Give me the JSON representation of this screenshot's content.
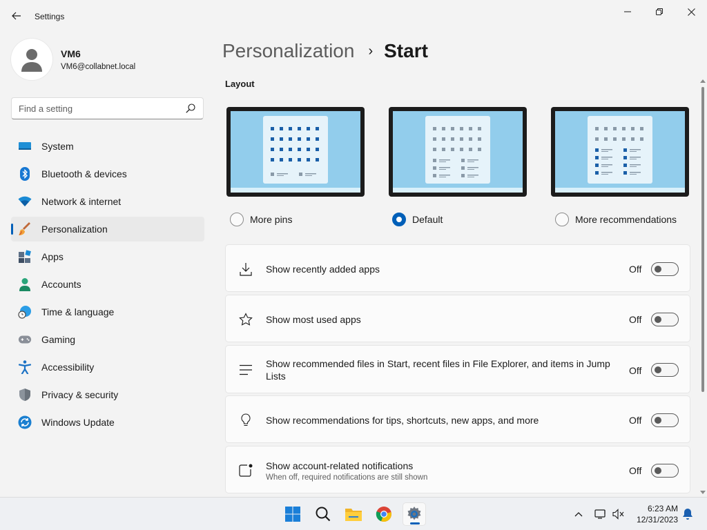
{
  "window": {
    "title": "Settings",
    "back_icon": "arrow-left",
    "controls": [
      "minimize",
      "maximize",
      "close"
    ]
  },
  "profile": {
    "name": "VM6",
    "email": "VM6@collabnet.local"
  },
  "search": {
    "placeholder": "Find a setting",
    "value": ""
  },
  "sidebar": {
    "items": [
      {
        "label": "System",
        "icon": "monitor-icon"
      },
      {
        "label": "Bluetooth & devices",
        "icon": "bluetooth-icon"
      },
      {
        "label": "Network & internet",
        "icon": "wifi-icon"
      },
      {
        "label": "Personalization",
        "icon": "paintbrush-icon",
        "selected": true
      },
      {
        "label": "Apps",
        "icon": "apps-icon"
      },
      {
        "label": "Accounts",
        "icon": "person-icon"
      },
      {
        "label": "Time & language",
        "icon": "globe-clock-icon"
      },
      {
        "label": "Gaming",
        "icon": "gamepad-icon"
      },
      {
        "label": "Accessibility",
        "icon": "accessibility-icon"
      },
      {
        "label": "Privacy & security",
        "icon": "shield-icon"
      },
      {
        "label": "Windows Update",
        "icon": "update-icon"
      }
    ]
  },
  "breadcrumb": {
    "parent": "Personalization",
    "separator": "›",
    "current": "Start"
  },
  "layout": {
    "title": "Layout",
    "options": [
      {
        "label": "More pins",
        "selected": false
      },
      {
        "label": "Default",
        "selected": true
      },
      {
        "label": "More recommendations",
        "selected": false
      }
    ]
  },
  "settings": [
    {
      "label": "Show recently added apps",
      "sub": "",
      "state": "Off",
      "icon": "download-icon"
    },
    {
      "label": "Show most used apps",
      "sub": "",
      "state": "Off",
      "icon": "star-icon"
    },
    {
      "label": "Show recommended files in Start, recent files in File Explorer, and items in Jump Lists",
      "sub": "",
      "state": "Off",
      "icon": "list-icon"
    },
    {
      "label": "Show recommendations for tips, shortcuts, new apps, and more",
      "sub": "",
      "state": "Off",
      "icon": "lightbulb-icon"
    },
    {
      "label": "Show account-related notifications",
      "sub": "When off, required notifications are still shown",
      "state": "Off",
      "icon": "notification-icon"
    }
  ],
  "taskbar": {
    "apps": [
      "start-icon",
      "search-icon",
      "file-explorer-icon",
      "chrome-icon",
      "settings-icon"
    ],
    "active_app": "settings-icon",
    "tray": [
      "chevron-up-icon",
      "network-icon",
      "volume-muted-icon",
      "bell-icon"
    ],
    "time": "6:23 AM",
    "date": "12/31/2023"
  },
  "colors": {
    "accent": "#005fb8",
    "window_bg": "#f3f3f3",
    "card_bg": "#fbfbfb",
    "preview_screen": "#92cdec"
  }
}
